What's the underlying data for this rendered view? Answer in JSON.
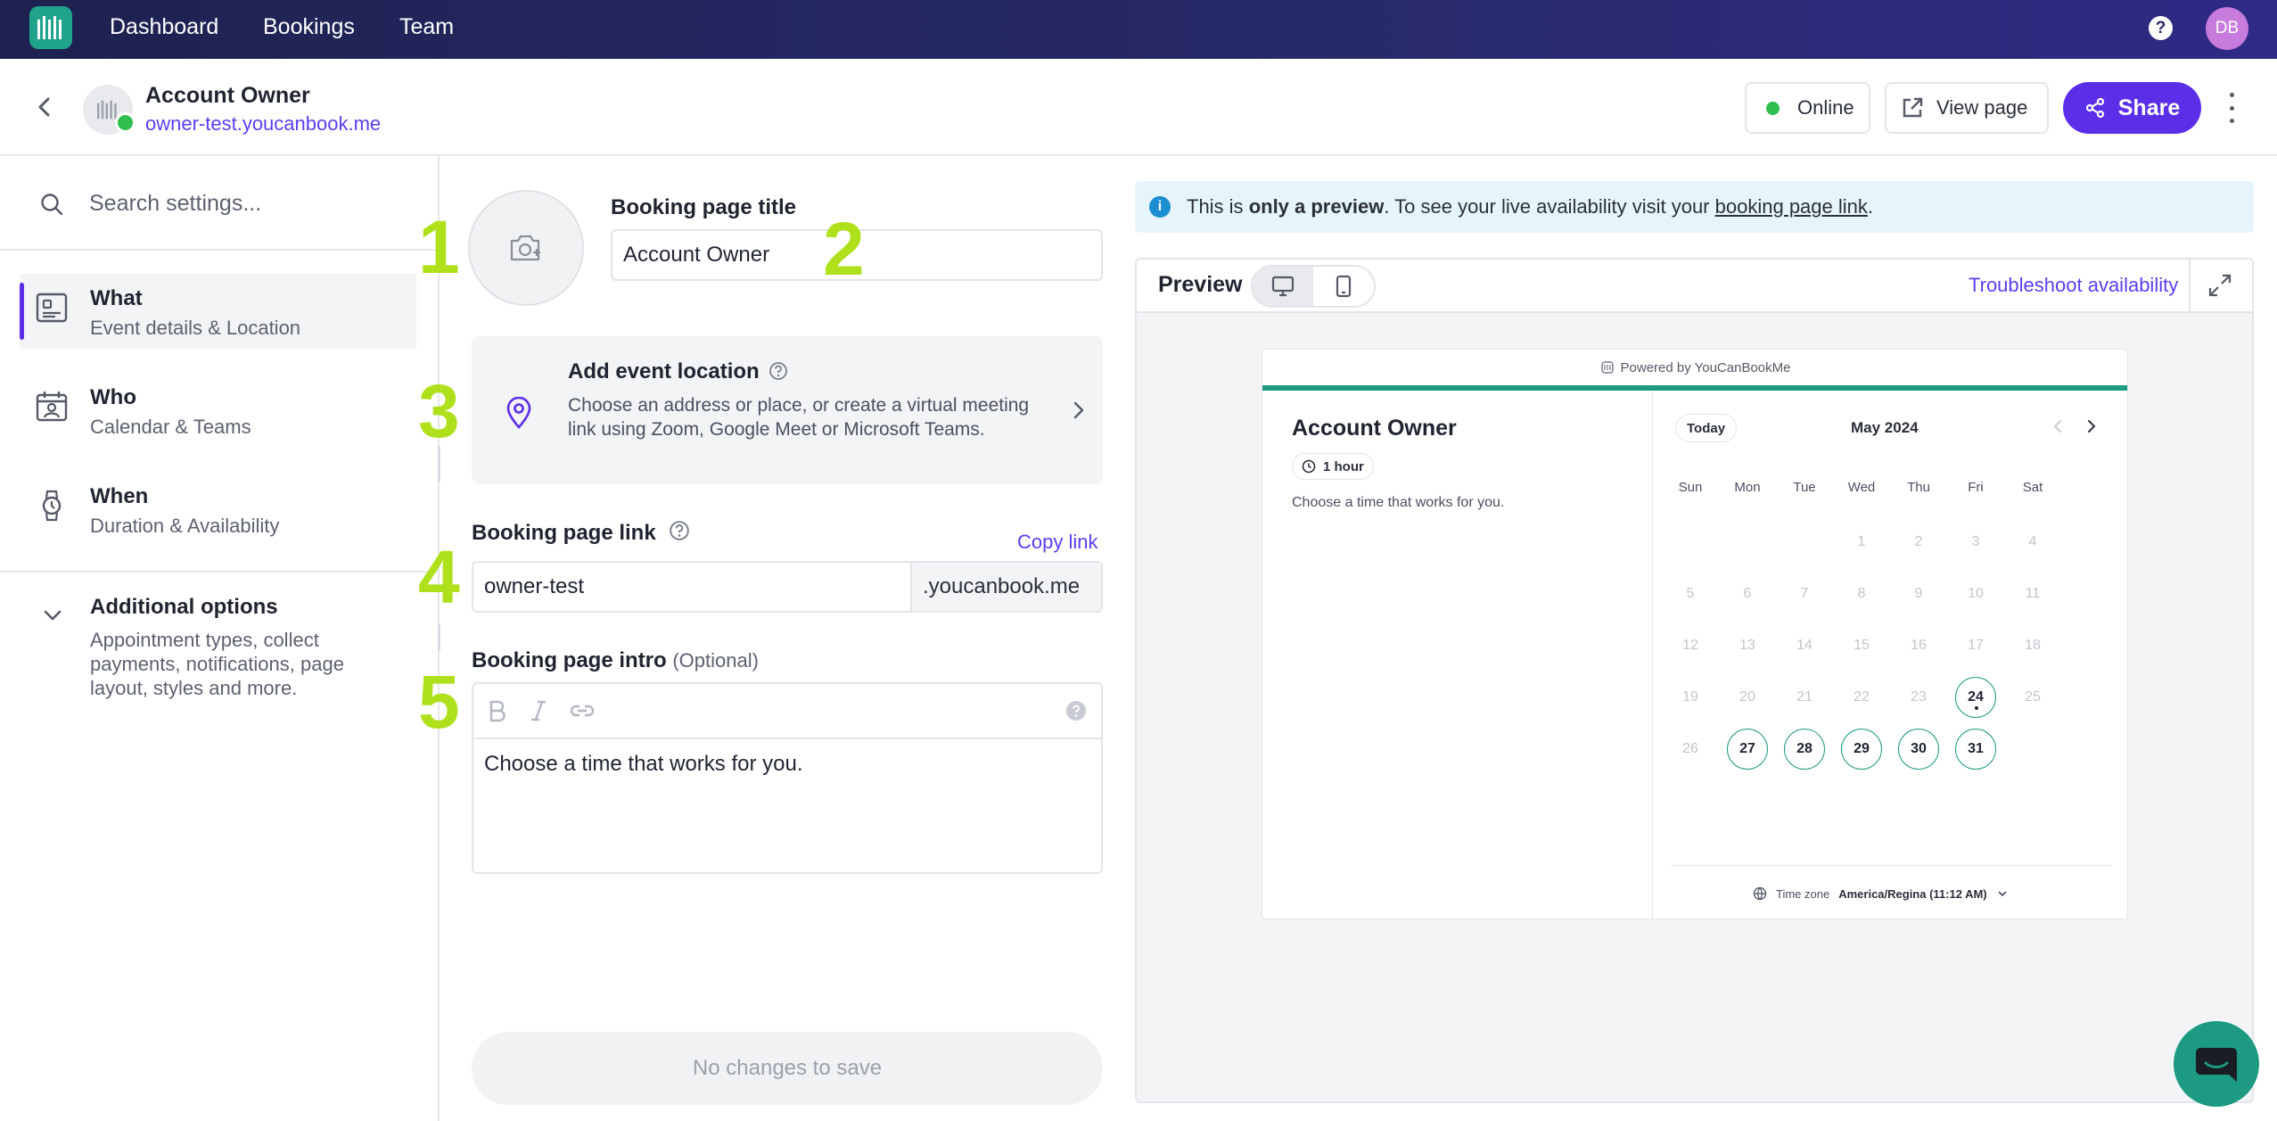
{
  "topnav": {
    "links": [
      "Dashboard",
      "Bookings",
      "Team"
    ],
    "help": "?",
    "avatar_initials": "DB"
  },
  "header": {
    "page_name": "Account Owner",
    "page_url": "owner-test.youcanbook.me",
    "status": "Online",
    "view_page": "View page",
    "share": "Share"
  },
  "sidebar": {
    "search_placeholder": "Search settings...",
    "items": [
      {
        "title": "What",
        "subtitle": "Event details & Location",
        "active": true
      },
      {
        "title": "Who",
        "subtitle": "Calendar & Teams",
        "active": false
      },
      {
        "title": "When",
        "subtitle": "Duration & Availability",
        "active": false
      }
    ],
    "additional": {
      "title": "Additional options",
      "subtitle": "Appointment types, collect payments, notifications, page layout, styles and more."
    }
  },
  "form": {
    "title_label": "Booking page title",
    "title_value": "Account Owner",
    "location_title": "Add event location",
    "location_desc": "Choose an address or place, or create a virtual meeting link using Zoom, Google Meet or Microsoft Teams.",
    "link_label": "Booking page link",
    "copy_link": "Copy link",
    "link_value": "owner-test",
    "link_suffix": ".youcanbook.me",
    "intro_label": "Booking page intro",
    "intro_optional": "(Optional)",
    "intro_value": "Choose a time that works for you.",
    "save_label": "No changes to save",
    "annotations": [
      "1",
      "2",
      "3",
      "4",
      "5"
    ]
  },
  "notice": {
    "prefix": "This is ",
    "bold": "only a preview",
    "middle": ". To see your live availability visit your ",
    "link": "booking page link",
    "suffix": "."
  },
  "preview": {
    "title": "Preview",
    "troubleshoot": "Troubleshoot availability",
    "powered_by": "Powered by YouCanBookMe",
    "event_name": "Account Owner",
    "duration": "1 hour",
    "description": "Choose a time that works for you.",
    "today": "Today",
    "month": "May 2024",
    "weekdays": [
      "Sun",
      "Mon",
      "Tue",
      "Wed",
      "Thu",
      "Fri",
      "Sat"
    ],
    "weeks": [
      [
        "",
        "",
        "",
        "1",
        "2",
        "3",
        "4"
      ],
      [
        "5",
        "6",
        "7",
        "8",
        "9",
        "10",
        "11"
      ],
      [
        "12",
        "13",
        "14",
        "15",
        "16",
        "17",
        "18"
      ],
      [
        "19",
        "20",
        "21",
        "22",
        "23",
        "24",
        "25"
      ],
      [
        "26",
        "27",
        "28",
        "29",
        "30",
        "31",
        ""
      ]
    ],
    "available_days": [
      "24",
      "27",
      "28",
      "29",
      "30",
      "31"
    ],
    "today_day": "24",
    "timezone_label": "Time zone",
    "timezone_value": "America/Regina (11:12 AM)"
  },
  "colors": {
    "brand": "#5b2ee8",
    "accent_green": "#1d9a82",
    "online": "#2fbf4f",
    "annotation": "#aee11b"
  }
}
